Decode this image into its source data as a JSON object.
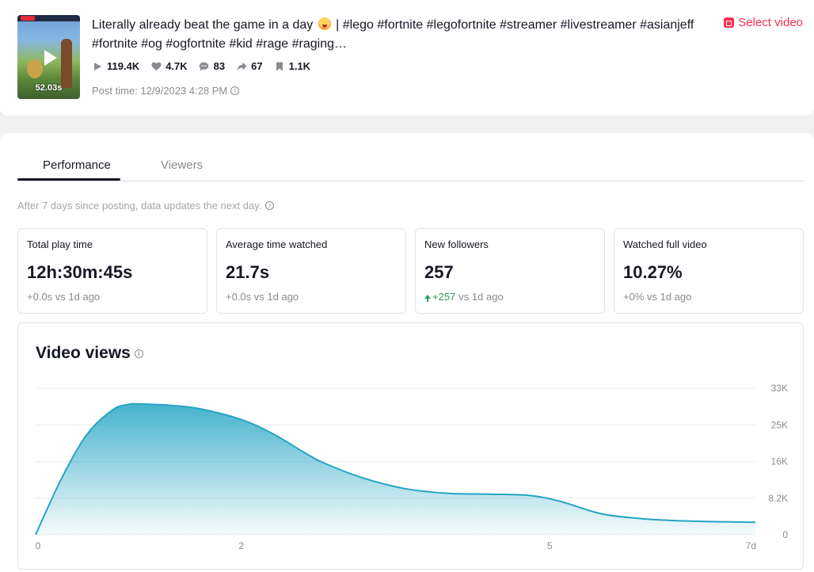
{
  "video": {
    "duration": "52.03s",
    "title_before_emoji": "Literally already beat the game in a day ",
    "title_after_emoji": " | #lego #fortnite #legofortnite #streamer #livestreamer #asianjeff #fortnite #og #ogfortnite #kid #rage #raging…",
    "stats": {
      "plays": "119.4K",
      "likes": "4.7K",
      "comments": "83",
      "shares": "67",
      "saves": "1.1K"
    },
    "post_time": "Post time: 12/9/2023 4:28 PM",
    "select_video_label": "Select video"
  },
  "tabs": [
    {
      "label": "Performance",
      "active": true
    },
    {
      "label": "Viewers",
      "active": false
    }
  ],
  "notice": "After 7 days since posting, data updates the next day.",
  "metrics": [
    {
      "label": "Total play time",
      "value": "12h:30m:45s",
      "delta": "+0.0s vs 1d ago"
    },
    {
      "label": "Average time watched",
      "value": "21.7s",
      "delta": "+0.0s vs 1d ago"
    },
    {
      "label": "New followers",
      "value": "257",
      "delta_up": "+257",
      "delta_rest": " vs 1d ago"
    },
    {
      "label": "Watched full video",
      "value": "10.27%",
      "delta": "+0% vs 1d ago"
    }
  ],
  "colors": {
    "accent": "#fe2c55",
    "positive": "#2a9d5c",
    "chart_line": "#25a5c4"
  },
  "chart_data": {
    "type": "area",
    "title": "Video views",
    "x_ticks": [
      "0",
      "2",
      "5",
      "7d"
    ],
    "y_ticks": [
      "0",
      "8.2K",
      "16K",
      "25K",
      "33K"
    ],
    "ylim": [
      0,
      33000
    ],
    "xlim": [
      0,
      7
    ],
    "grid": true,
    "x": [
      0,
      0.25,
      0.5,
      0.75,
      0.9,
      1.0,
      1.3,
      1.6,
      2.0,
      2.3,
      2.6,
      2.8,
      3.2,
      3.6,
      4.0,
      4.4,
      4.8,
      5.1,
      5.5,
      5.9,
      6.3,
      6.7,
      7.0
    ],
    "values": [
      0,
      12500,
      22500,
      28000,
      29200,
      29300,
      29000,
      28200,
      25800,
      22700,
      18600,
      16100,
      12600,
      10300,
      9300,
      9100,
      8800,
      7500,
      4700,
      3600,
      3100,
      2900,
      2800
    ]
  }
}
